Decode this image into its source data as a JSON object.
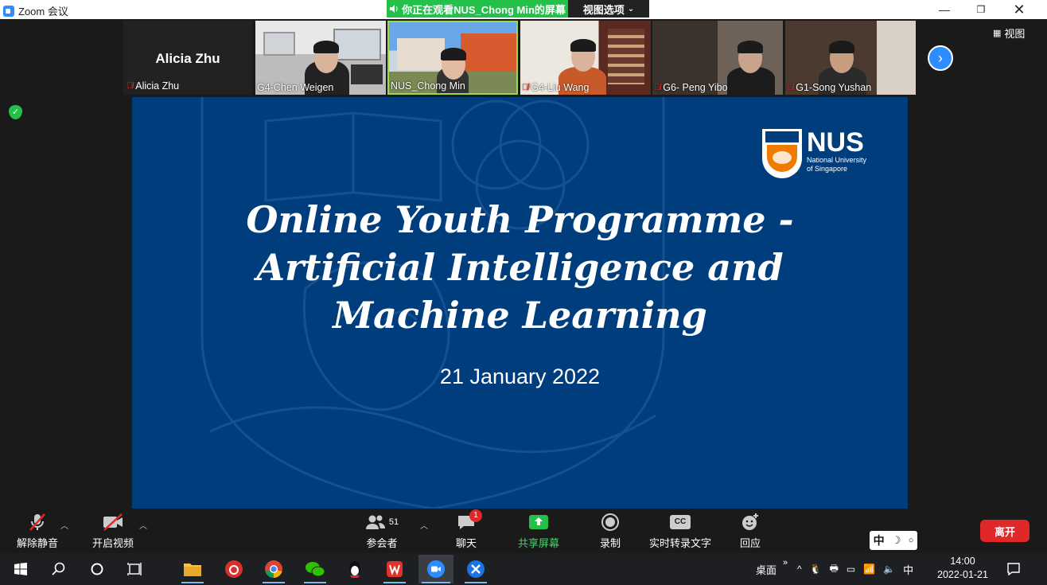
{
  "window": {
    "title": "Zoom 会议",
    "viewing_banner": "你正在观看NUS_Chong  Min的屏幕",
    "view_options": "视图选项"
  },
  "gallery": {
    "active_name": "Alicia Zhu",
    "participants": [
      {
        "name": "Alicia Zhu",
        "muted": true
      },
      {
        "name": "G4-Chen Weigen",
        "muted": false
      },
      {
        "name": "NUS_Chong Min",
        "muted": false
      },
      {
        "name": "G4-Liu Wang",
        "muted": true
      },
      {
        "name": "G6- Peng Yibo",
        "muted": true
      },
      {
        "name": "G1-Song Yushan",
        "muted": true
      }
    ],
    "view_label": "视图"
  },
  "slide": {
    "title_lines": [
      "Online Youth Programme -",
      "Artificial Intelligence and",
      "Machine Learning"
    ],
    "date": "21 January 2022",
    "logo_big": "NUS",
    "logo_line1": "National University",
    "logo_line2": "of Singapore",
    "bg_color": "#003d7c"
  },
  "toolbar": {
    "unmute": "解除静音",
    "start_video": "开启视频",
    "participants": "参会者",
    "participants_count": "51",
    "chat": "聊天",
    "chat_badge": "1",
    "share": "共享屏幕",
    "record": "录制",
    "caption": "实时转录文字",
    "reactions": "回应",
    "leave": "离开",
    "cc": "CC"
  },
  "ime": {
    "mode": "中"
  },
  "taskbar": {
    "desktop": "桌面",
    "ime": "中",
    "time": "14:00",
    "date": "2022-01-21"
  },
  "colors": {
    "accent_green": "#23c149",
    "zoom_blue": "#2d8cff",
    "leave_red": "#e02828"
  }
}
